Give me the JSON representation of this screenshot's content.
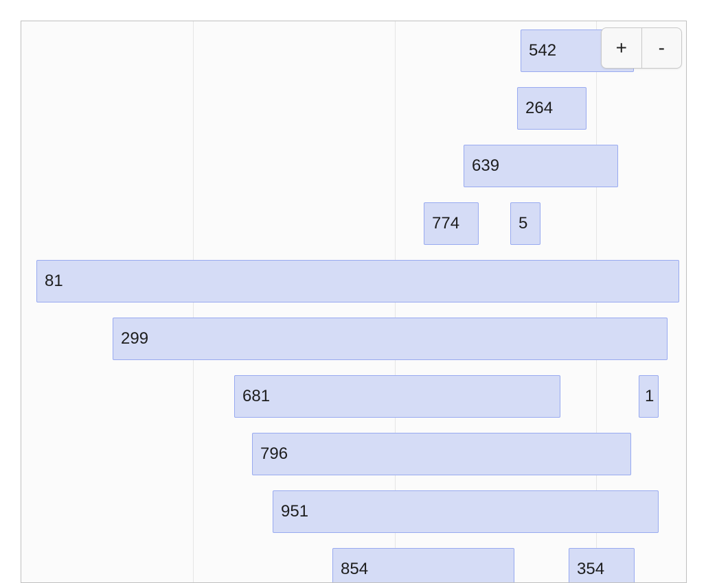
{
  "timeline": {
    "items": [
      {
        "label": "542"
      },
      {
        "label": "264"
      },
      {
        "label": "639"
      },
      {
        "label": "774"
      },
      {
        "label": "5"
      },
      {
        "label": "81"
      },
      {
        "label": "299"
      },
      {
        "label": "681"
      },
      {
        "label": "1"
      },
      {
        "label": "796"
      },
      {
        "label": "951"
      },
      {
        "label": "854"
      },
      {
        "label": "354"
      }
    ],
    "colors": {
      "item_fill": "#d5dcf6",
      "item_border": "#97a9f0",
      "gridline": "#e5e5e5",
      "frame": "#bfbfbf"
    }
  },
  "zoom": {
    "in_label": "+",
    "out_label": "-"
  }
}
